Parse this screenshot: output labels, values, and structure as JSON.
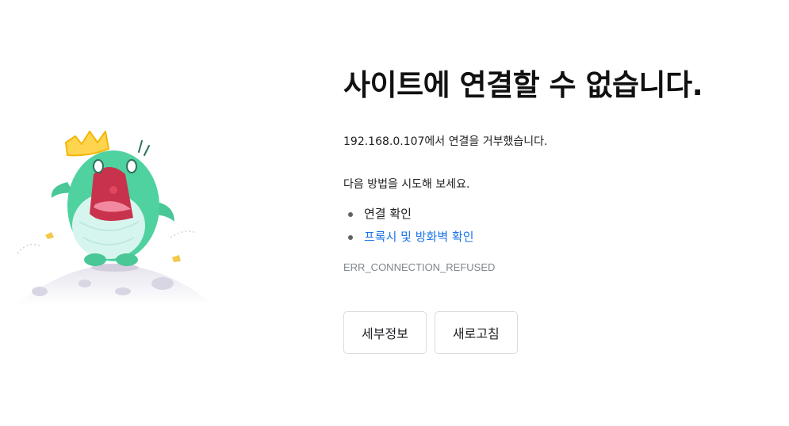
{
  "error": {
    "title": "사이트에 연결할 수 없습니다.",
    "description": "192.168.0.107에서 연결을 거부했습니다.",
    "try_label": "다음 방법을 시도해 보세요.",
    "suggestions": [
      {
        "label": "연결 확인",
        "is_link": false
      },
      {
        "label": "프록시 및 방화벽 확인",
        "is_link": true
      }
    ],
    "code": "ERR_CONNECTION_REFUSED"
  },
  "buttons": {
    "details_label": "세부정보",
    "reload_label": "새로고침"
  },
  "colors": {
    "link": "#1a73e8",
    "mascot": "#4fd1a0",
    "mascot_mouth": "#e24c63",
    "crown": "#ffd54f",
    "moon": "#e9e7f0"
  },
  "illustration": {
    "icon": "shouting-mascot-on-moon-icon"
  }
}
